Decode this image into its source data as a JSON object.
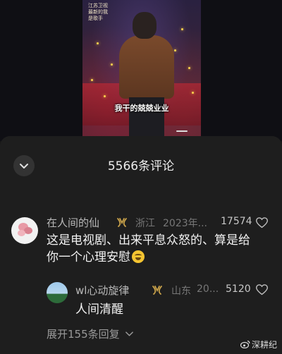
{
  "video": {
    "subtitle": "我干的兢兢业业",
    "side_text": "江苏卫视 最新的我是歌手"
  },
  "comments_header": {
    "title": "5566条评论"
  },
  "comment": {
    "username": "在人间的仙",
    "location": "浙江",
    "date": "2023年...",
    "likes": "17574",
    "text": "这是电视剧、出来平息众怒的、算是给你一个心理安慰",
    "emoji": "grinning-sweat-emoji"
  },
  "reply": {
    "username": "wl心动旋律",
    "location": "山东",
    "date": "20...",
    "likes": "5120",
    "text": "人间清醒"
  },
  "expand": {
    "label": "展开155条回复"
  },
  "watermark": {
    "text": "深耕纪"
  },
  "colors": {
    "sheet_bg": "#1e1e1e",
    "badge_gold": "#c9a24a",
    "muted": "#777777"
  }
}
